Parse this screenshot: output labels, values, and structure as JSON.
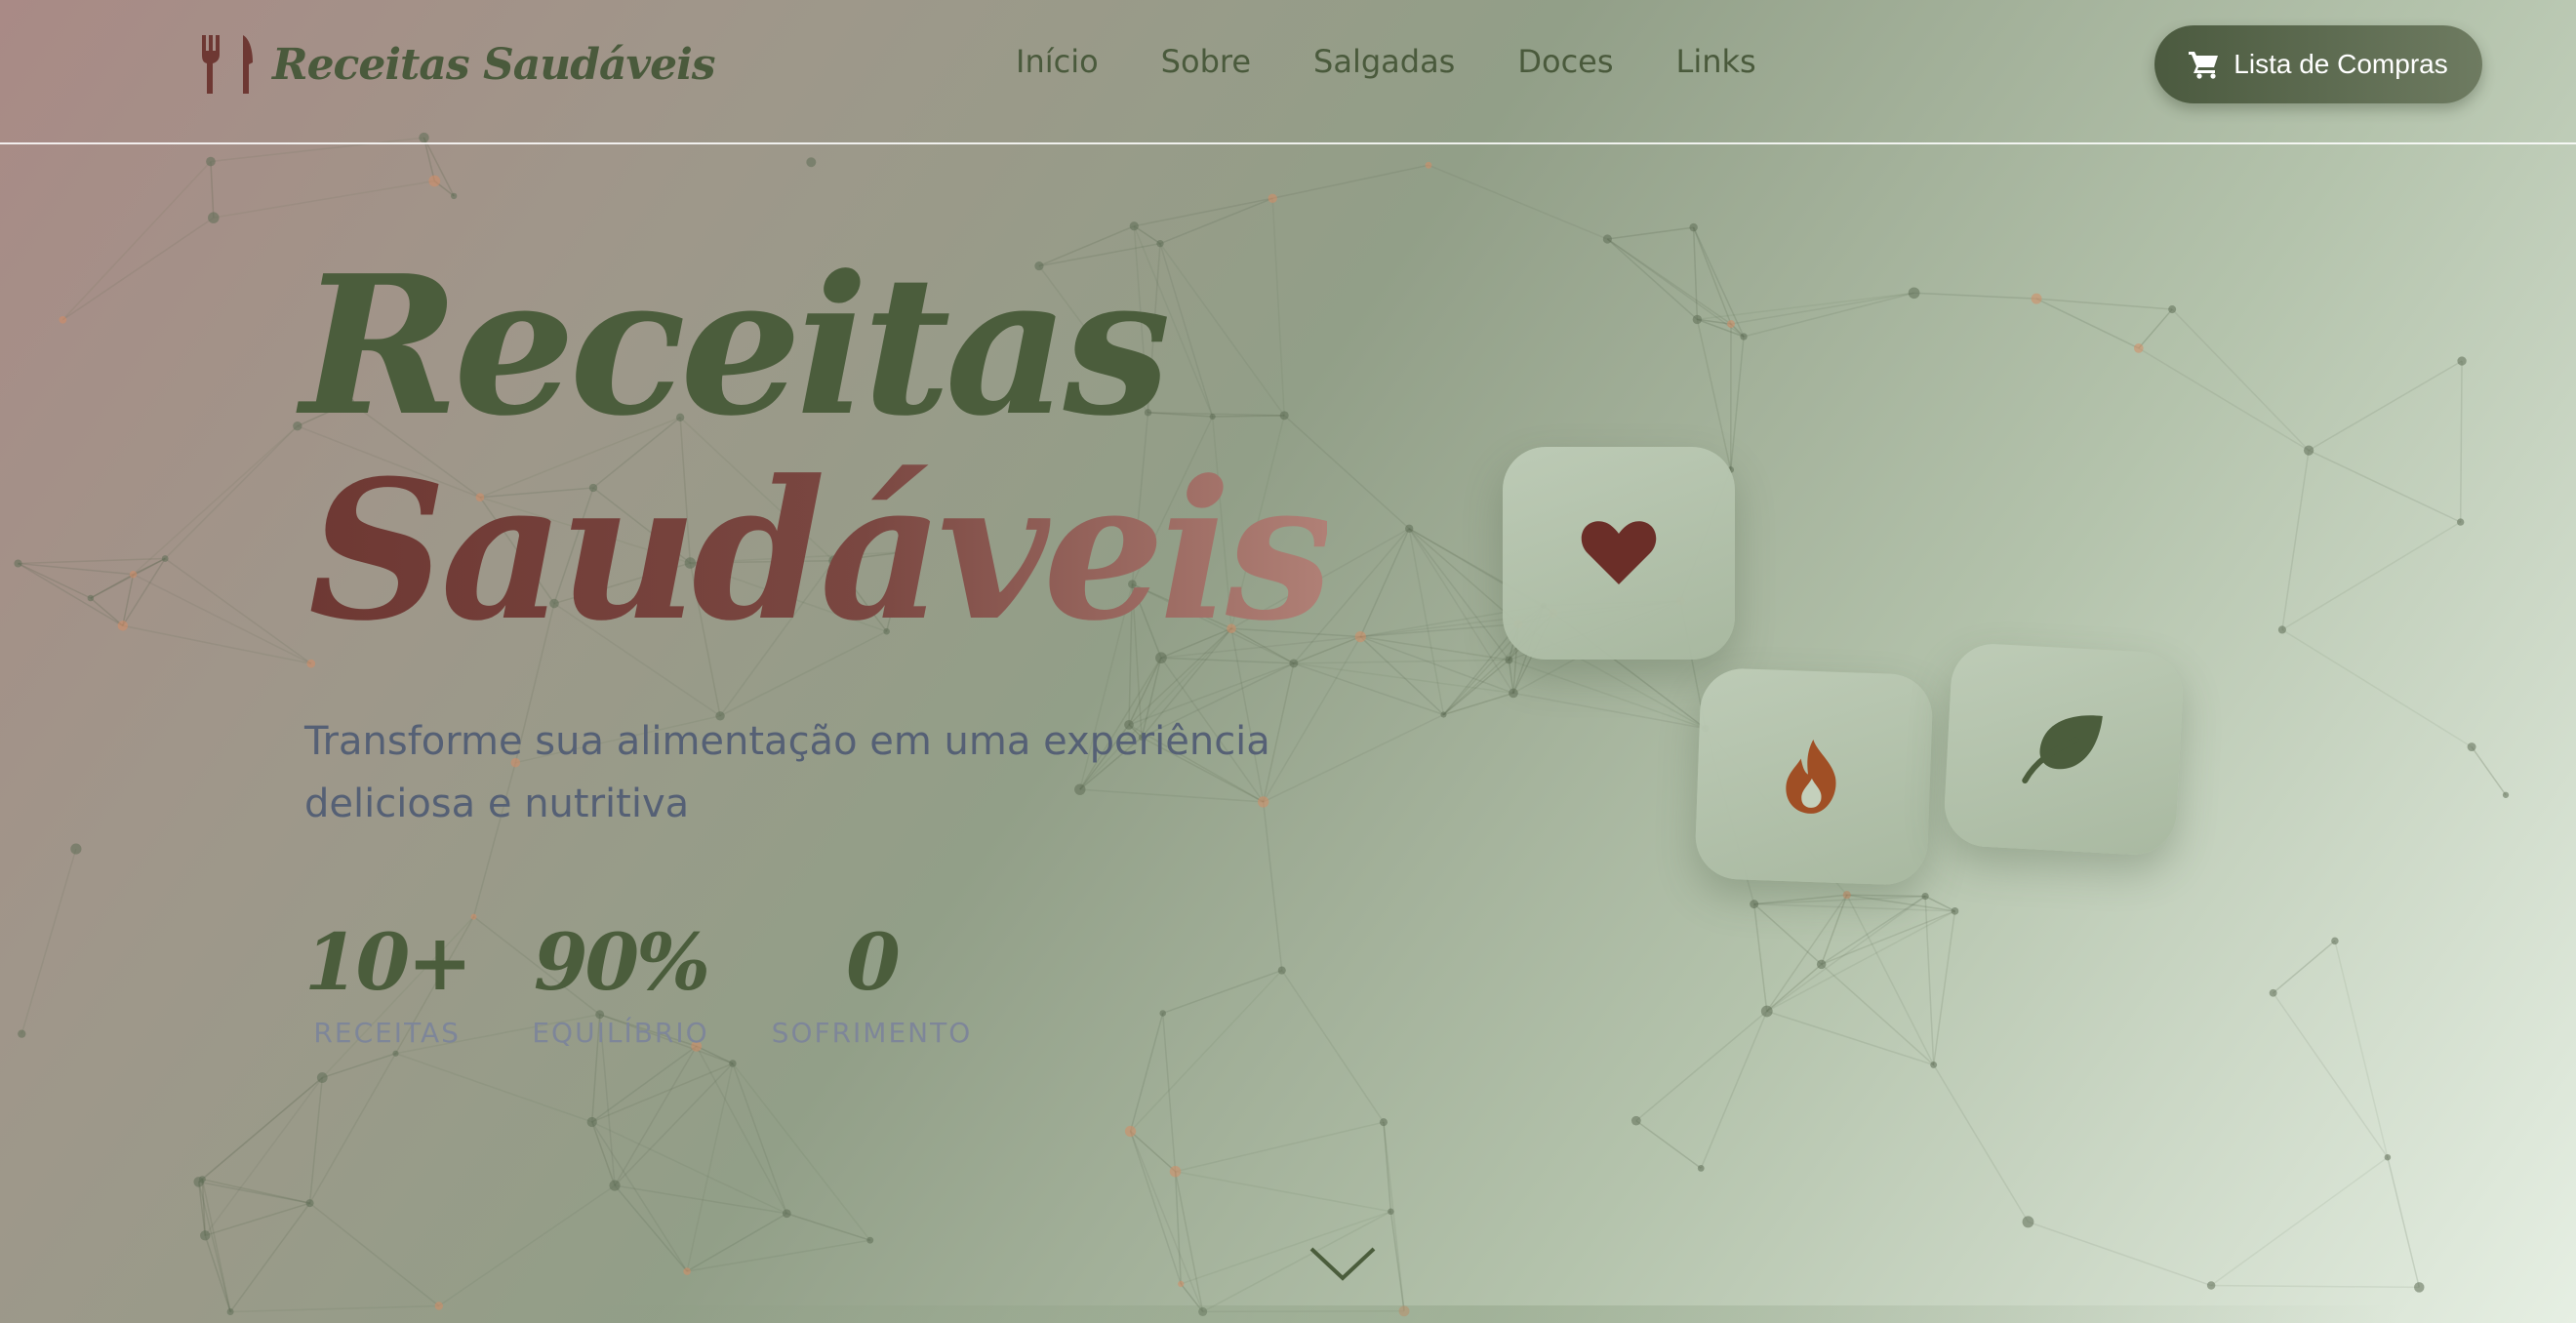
{
  "brand": {
    "name": "Receitas Saudáveis",
    "icon": "utensils-icon"
  },
  "nav": {
    "items": [
      "Início",
      "Sobre",
      "Salgadas",
      "Doces",
      "Links"
    ]
  },
  "cart": {
    "label": "Lista de Compras",
    "icon": "shopping-cart-icon"
  },
  "hero": {
    "title_line1": "Receitas",
    "title_line2": "Saudáveis",
    "subtitle": "Transforme sua alimentação em uma experiência deliciosa e nutritiva",
    "stats": [
      {
        "value": "10+",
        "label": "RECEITAS"
      },
      {
        "value": "90%",
        "label": "EQUILÍBRIO"
      },
      {
        "value": "0",
        "label": "SOFRIMENTO"
      }
    ]
  },
  "cards": [
    {
      "icon": "heart-icon",
      "color": "#6b2e28"
    },
    {
      "icon": "fire-icon",
      "color": "#a04f25"
    },
    {
      "icon": "leaf-icon",
      "color": "#4b5d3c"
    }
  ],
  "scroll": {
    "icon": "chevron-down-icon"
  },
  "colors": {
    "primary_green": "#4b5d3c",
    "accent_red": "#6e3833",
    "subtitle": "#556075",
    "stat_label": "#7e8699"
  }
}
